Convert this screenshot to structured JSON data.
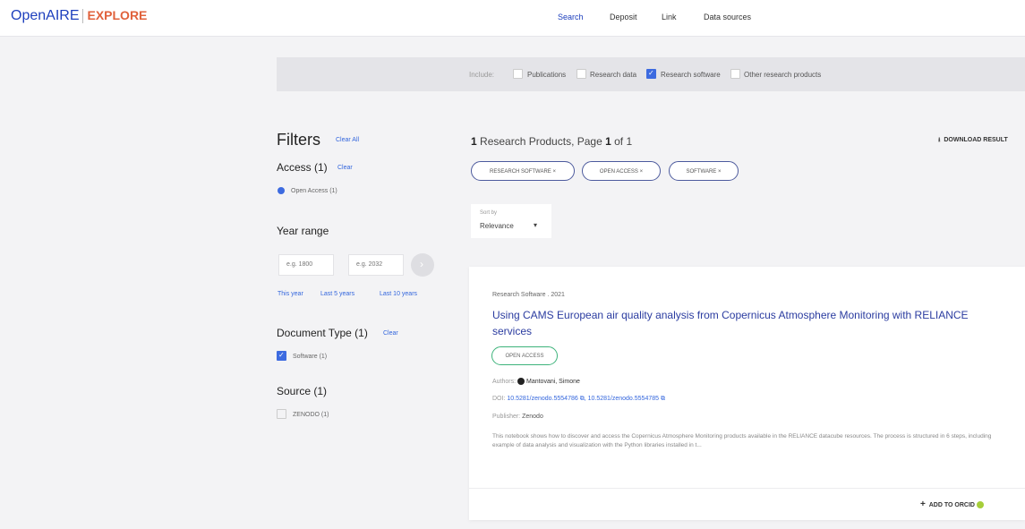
{
  "header": {
    "logo_open": "OpenAIRE",
    "logo_explore": "EXPLORE",
    "nav": [
      "Search",
      "Deposit",
      "Link",
      "Data sources"
    ]
  },
  "include_bar": {
    "label": "Include:",
    "options": [
      {
        "label": "Publications",
        "checked": false
      },
      {
        "label": "Research data",
        "checked": false
      },
      {
        "label": "Research software",
        "checked": true
      },
      {
        "label": "Other research products",
        "checked": false
      }
    ]
  },
  "filters": {
    "title": "Filters",
    "clear_all": "Clear All",
    "access": {
      "title": "Access (1)",
      "clear": "Clear",
      "option": "Open Access (1)"
    },
    "year_range": {
      "title": "Year range",
      "from_placeholder": "e.g. 1800",
      "to_placeholder": "e.g. 2032",
      "shortcuts": [
        "This year",
        "Last 5 years",
        "Last 10 years"
      ]
    },
    "document_type": {
      "title": "Document Type (1)",
      "clear": "Clear",
      "option": "Software (1)"
    },
    "source": {
      "title": "Source (1)",
      "option": "ZENODO (1)"
    }
  },
  "results": {
    "count_prefix": "1",
    "count_text": " Research Products, Page ",
    "page": "1",
    "of_text": " of 1",
    "download": "DOWNLOAD RESULT",
    "chips": [
      "RESEARCH SOFTWARE ×",
      "OPEN ACCESS ×",
      "SOFTWARE ×"
    ],
    "sort": {
      "label": "Sort by",
      "value": "Relevance"
    }
  },
  "card": {
    "meta": "Research Software . 2021",
    "title": "Using CAMS European air quality analysis from Copernicus Atmosphere Monitoring with RELIANCE services",
    "badge": "OPEN ACCESS",
    "authors_label": "Authors:",
    "authors": "Mantovani, Simone",
    "doi_label": "DOI:",
    "doi1": "10.5281/zenodo.5554786",
    "doi2": "10.5281/zenodo.5554785",
    "publisher_label": "Publisher:",
    "publisher": "Zenodo",
    "description": "This notebook shows how to discover and access the Copernicus Atmosphere Monitoring products available in the RELIANCE datacube resources. The process is structured in 6 steps, including example of data analysis and visualization with the Python libraries installed in t...",
    "add_orcid": "ADD TO ORCID"
  },
  "colors": {
    "primary": "#1d3fbd",
    "accent": "#e0613b",
    "link": "#3366dd",
    "open_access": "#3db37b"
  }
}
